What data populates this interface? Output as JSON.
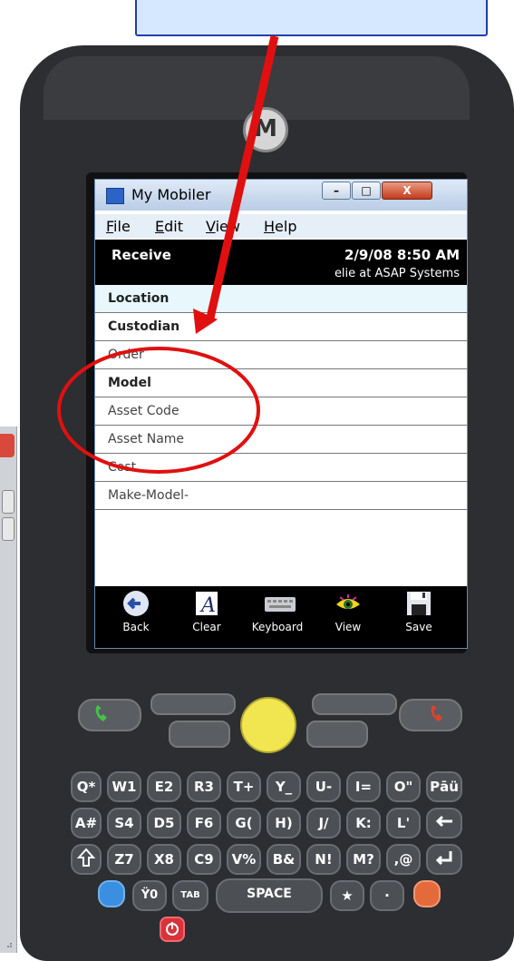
{
  "window": {
    "title": "My Mobiler",
    "controls": [
      "–",
      "□",
      "X"
    ]
  },
  "menu": [
    "File",
    "Edit",
    "View",
    "Help"
  ],
  "header": {
    "screen_label": "Receive",
    "datetime": "2/9/08 8:50 AM",
    "user": "elie at ASAP Systems"
  },
  "fields": [
    {
      "label": "Location",
      "bold": true,
      "highlight": true
    },
    {
      "label": "Custodian",
      "bold": true,
      "highlight": false
    },
    {
      "label": "Order",
      "bold": false,
      "highlight": false
    },
    {
      "label": "Model",
      "bold": true,
      "highlight": false
    },
    {
      "label": "Asset Code",
      "bold": false,
      "highlight": false
    },
    {
      "label": "Asset Name",
      "bold": false,
      "highlight": false
    },
    {
      "label": "Cost",
      "bold": false,
      "highlight": false
    },
    {
      "label": "Make-Model-",
      "bold": false,
      "highlight": false
    }
  ],
  "toolbar": [
    {
      "label": "Back",
      "icon": "back-arrow-icon"
    },
    {
      "label": "Clear",
      "icon": "font-a-icon"
    },
    {
      "label": "Keyboard",
      "icon": "keyboard-icon"
    },
    {
      "label": "View",
      "icon": "eye-icon"
    },
    {
      "label": "Save",
      "icon": "floppy-disk-icon"
    }
  ],
  "keys": {
    "row1": [
      "Q*",
      "W1",
      "E2",
      "R3",
      "T+",
      "Y_",
      "U-",
      "I=",
      "O\"",
      "Pāü"
    ],
    "row2": [
      "A#",
      "S4",
      "D5",
      "F6",
      "G(",
      "H)",
      "J/",
      "K:",
      "L'"
    ],
    "row3": [
      "Z7",
      "X8",
      "C9",
      "V%",
      "B&",
      "N!",
      "M?",
      ",@"
    ],
    "row4": [
      "Ÿ0",
      "TAB",
      "SPACE",
      "★",
      "·"
    ]
  },
  "brand_logo": "M",
  "colors": {
    "annotation_red": "#e01010",
    "callout_border": "#1f3fa8",
    "titlebar_close": "#c33b1b",
    "screen_black": "#000000"
  }
}
